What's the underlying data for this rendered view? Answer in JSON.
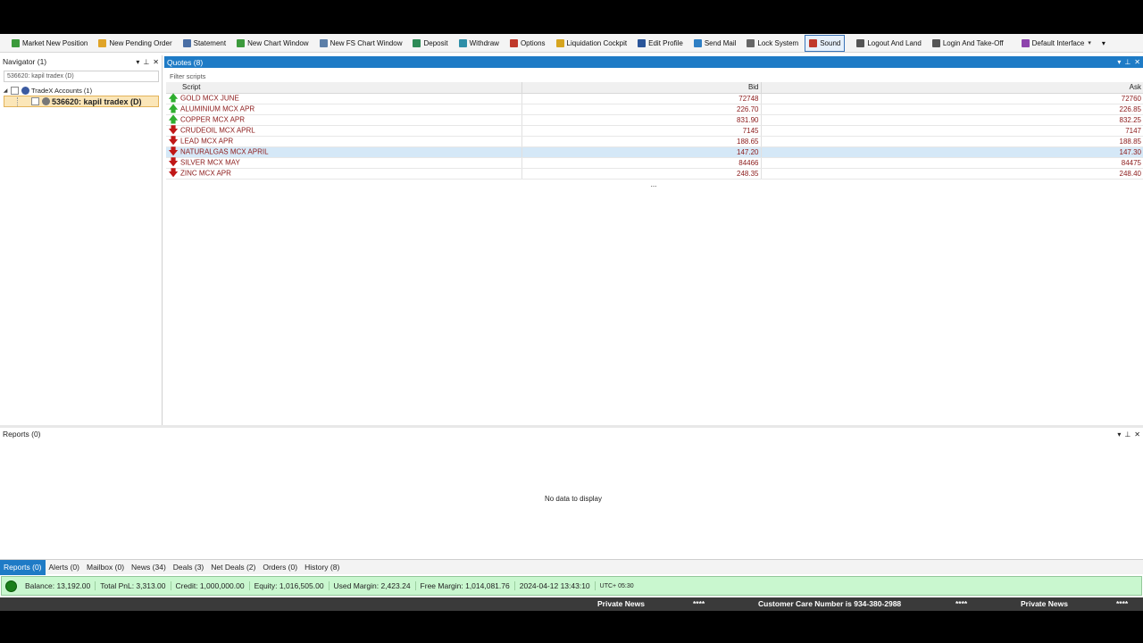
{
  "toolbar": {
    "items": [
      {
        "label": "Market New Position",
        "icon": "market-position-icon",
        "color": "#3c9a3c"
      },
      {
        "label": "New Pending Order",
        "icon": "pending-order-icon",
        "color": "#e0a428"
      },
      {
        "label": "Statement",
        "icon": "statement-icon",
        "color": "#4a6fa5"
      },
      {
        "label": "New Chart Window",
        "icon": "chart-icon",
        "color": "#3c9a3c"
      },
      {
        "label": "New FS Chart Window",
        "icon": "fs-chart-icon",
        "color": "#5c7fa8"
      },
      {
        "label": "Deposit",
        "icon": "deposit-icon",
        "color": "#2e8b57"
      },
      {
        "label": "Withdraw",
        "icon": "withdraw-icon",
        "color": "#2f8fa8"
      },
      {
        "label": "Options",
        "icon": "options-icon",
        "color": "#c0392b"
      },
      {
        "label": "Liquidation Cockpit",
        "icon": "liquidation-icon",
        "color": "#d6a520"
      },
      {
        "label": "Edit Profile",
        "icon": "profile-icon",
        "color": "#2a5599"
      },
      {
        "label": "Send Mail",
        "icon": "mail-icon",
        "color": "#2f7fc4"
      },
      {
        "label": "Lock System",
        "icon": "lock-icon",
        "color": "#666666"
      },
      {
        "label": "Sound",
        "icon": "sound-icon",
        "color": "#c0392b"
      },
      {
        "label": "Logout And Land",
        "icon": "logout-icon",
        "color": "#555555"
      },
      {
        "label": "Login And Take-Off",
        "icon": "login-icon",
        "color": "#555555"
      },
      {
        "label": "Default Interface",
        "icon": "interface-icon",
        "color": "#8e44ad"
      }
    ],
    "active": "Sound"
  },
  "navigator": {
    "title": "Navigator (1)",
    "search_value": "536620: kapil tradex (D)",
    "root_label": "TradeX Accounts (1)",
    "account_label": "536620: kapil tradex (D)"
  },
  "quotes": {
    "title": "Quotes (8)",
    "filter_placeholder": "Filter scripts",
    "columns": {
      "script": "Script",
      "bid": "Bid",
      "ask": "Ask"
    },
    "rows": [
      {
        "script": "GOLD MCX JUNE",
        "bid": "72748",
        "ask": "72760",
        "trend": "up"
      },
      {
        "script": "ALUMINIUM MCX APR",
        "bid": "226.70",
        "ask": "226.85",
        "trend": "up"
      },
      {
        "script": "COPPER MCX APR",
        "bid": "831.90",
        "ask": "832.25",
        "trend": "up"
      },
      {
        "script": "CRUDEOIL MCX APRL",
        "bid": "7145",
        "ask": "7147",
        "trend": "down"
      },
      {
        "script": "LEAD MCX APR",
        "bid": "188.65",
        "ask": "188.85",
        "trend": "down"
      },
      {
        "script": "NATURALGAS MCX APRIL",
        "bid": "147.20",
        "ask": "147.30",
        "trend": "down"
      },
      {
        "script": "SILVER MCX MAY",
        "bid": "84466",
        "ask": "84475",
        "trend": "down"
      },
      {
        "script": "ZINC MCX APR",
        "bid": "248.35",
        "ask": "248.40",
        "trend": "down"
      }
    ],
    "highlighted_row": 5,
    "more": "..."
  },
  "reports": {
    "title": "Reports (0)",
    "empty_text": "No data to display"
  },
  "bottom_tabs": [
    "Reports (0)",
    "Alerts (0)",
    "Mailbox (0)",
    "News (34)",
    "Deals (3)",
    "Net Deals (2)",
    "Orders (0)",
    "History (8)"
  ],
  "account": {
    "balance": "Balance:  13,192.00",
    "total_pnl": "Total PnL:  3,313.00",
    "credit": "Credit:  1,000,000.00",
    "equity": "Equity:  1,016,505.00",
    "used_margin": "Used Margin:  2,423.24",
    "free_margin": "Free Margin:  1,014,081.76",
    "datetime": "2024-04-12 13:43:10",
    "utc": "UTC+ 05:30"
  },
  "ticker": {
    "items": [
      "Private News",
      "****",
      "Customer Care Number is 934-380-2988",
      "****",
      "Private News",
      "****"
    ]
  },
  "colors": {
    "accent": "#1e7bc6",
    "price_text": "#8b1a1a",
    "up": "#2fae2f",
    "down": "#c01717",
    "account_bar": "#c9f7cf"
  }
}
